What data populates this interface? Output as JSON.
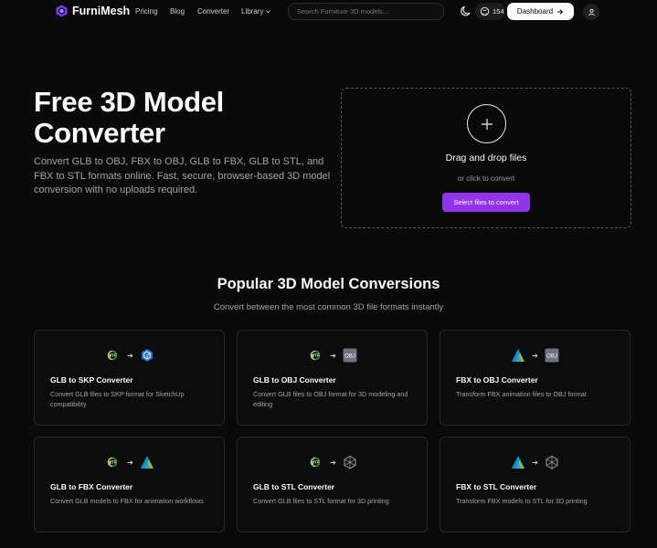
{
  "nav": {
    "brand": "FurniMesh",
    "links": [
      "Pricing",
      "Blog",
      "Converter",
      "Library"
    ],
    "search_placeholder": "Search Furniture 3D models...",
    "github_stars": "154",
    "dashboard_label": "Dashboard"
  },
  "hero": {
    "title": "Free 3D Model Converter",
    "subtitle": "Convert GLB to OBJ, FBX to OBJ, GLB to FBX, GLB to STL, and FBX to STL formats online. Fast, secure, browser-based 3D model conversion with no uploads required."
  },
  "dropzone": {
    "title": "Drag and drop files",
    "or_text": "or click to convert",
    "button_label": "Select files to convert"
  },
  "section": {
    "title": "Popular 3D Model Conversions",
    "subtitle": "Convert between the most common 3D file formats instantly"
  },
  "cards": [
    {
      "title": "GLB to SKP Converter",
      "desc": "Convert GLB files to SKP format for SketchUp compatibility",
      "from_icon": "gltf-icon",
      "to_icon": "sketchup-icon"
    },
    {
      "title": "GLB to OBJ Converter",
      "desc": "Convert GLB files to OBJ format for 3D modeling and editing",
      "from_icon": "gltf-icon",
      "to_icon": "obj-icon"
    },
    {
      "title": "FBX to OBJ Converter",
      "desc": "Transform FBX animation files to OBJ format",
      "from_icon": "autodesk-icon",
      "to_icon": "obj-icon"
    },
    {
      "title": "GLB to FBX Converter",
      "desc": "Convert GLB models to FBX for animation workflows",
      "from_icon": "gltf-icon",
      "to_icon": "autodesk-icon"
    },
    {
      "title": "GLB to STL Converter",
      "desc": "Convert GLB files to STL format for 3D printing",
      "from_icon": "gltf-icon",
      "to_icon": "stl-icon"
    },
    {
      "title": "FBX to STL Converter",
      "desc": "Transform FBX models to STL for 3D printing",
      "from_icon": "autodesk-icon",
      "to_icon": "stl-icon"
    }
  ],
  "icon_labels": {
    "obj": "OBJ",
    "gltf": "glTF"
  },
  "colors": {
    "accent": "#9333ea",
    "background": "#0a0a0a",
    "card_border": "#262626"
  }
}
